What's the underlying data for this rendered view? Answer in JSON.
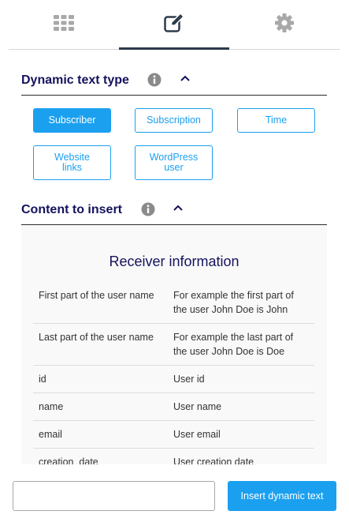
{
  "tabs": [
    {
      "name": "grid-icon",
      "active": false
    },
    {
      "name": "edit-icon",
      "active": true
    },
    {
      "name": "gear-icon",
      "active": false
    }
  ],
  "colors": {
    "accent": "#1ba0f0",
    "heading": "#15135e",
    "icon_gray": "#a8a8a8"
  },
  "dynamic_text_type": {
    "title": "Dynamic text type",
    "buttons": [
      {
        "label": "Subscriber",
        "selected": true
      },
      {
        "label": "Subscription",
        "selected": false
      },
      {
        "label": "Time",
        "selected": false
      },
      {
        "label": "Website links",
        "selected": false
      },
      {
        "label": "WordPress user",
        "selected": false
      }
    ]
  },
  "content_to_insert": {
    "title": "Content to insert",
    "receiver_title": "Receiver information",
    "rows": [
      {
        "field": "First part of the user name",
        "description": "For example the first part of the user John Doe is John"
      },
      {
        "field": "Last part of the user name",
        "description": "For example the last part of the user John Doe is Doe"
      },
      {
        "field": "id",
        "description": "User id"
      },
      {
        "field": "name",
        "description": "User name"
      },
      {
        "field": "email",
        "description": "User email"
      },
      {
        "field": "creation_date",
        "description": "User creation date"
      }
    ]
  },
  "bottom": {
    "input_value": "",
    "insert_label": "Insert dynamic text"
  }
}
